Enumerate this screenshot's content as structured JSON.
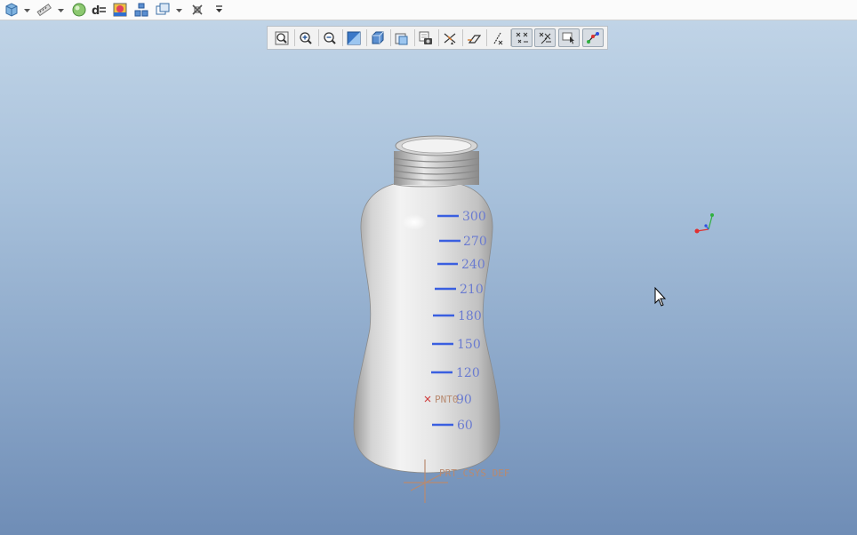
{
  "toolbar": {
    "quick_access": [
      "part-icon",
      "measure-icon",
      "appearance-icon",
      "dimension-icon",
      "color-icon",
      "model-tree-icon",
      "windows-icon",
      "close-window-icon"
    ],
    "overflow": "chevron-down-icon"
  },
  "view_toolbar": {
    "buttons": [
      "refit-icon",
      "zoom-in-icon",
      "zoom-out-icon",
      "repaint-icon",
      "display-style-icon",
      "saved-views-icon",
      "view-manager-icon",
      "plane-display-icon",
      "axis-display-icon",
      "point-display-icon",
      "csys-display-icon",
      "point-tag-icon",
      "csys-tag-icon",
      "spin-center-icon"
    ]
  },
  "model": {
    "graduations": [
      "300",
      "270",
      "240",
      "210",
      "180",
      "150",
      "120",
      "90",
      "60"
    ],
    "point_label": "PNT0",
    "csys_label": "PRT_CSYS_DEF"
  },
  "colors": {
    "graduation": "#3a5fe0",
    "datum": "#b88a70",
    "axis_x": "#e03030",
    "axis_y": "#30b040",
    "axis_z": "#3050e0"
  }
}
